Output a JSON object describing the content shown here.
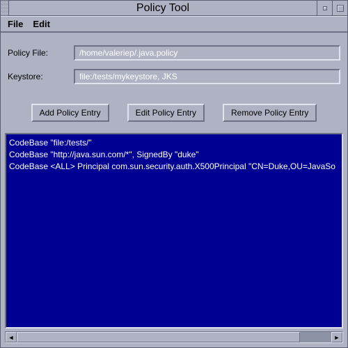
{
  "window": {
    "title": "Policy Tool"
  },
  "menu": {
    "file": "File",
    "edit": "Edit"
  },
  "form": {
    "policy_file_label": "Policy File:",
    "policy_file_value": "/home/valeriep/.java.policy",
    "keystore_label": "Keystore:",
    "keystore_value": "file:/tests/mykeystore, JKS"
  },
  "buttons": {
    "add": "Add Policy Entry",
    "edit": "Edit Policy Entry",
    "remove": "Remove Policy Entry"
  },
  "entries": [
    "CodeBase \"file:/tests/\"",
    "CodeBase \"http://java.sun.com/*\", SignedBy \"duke\"",
    "CodeBase <ALL>  Principal com.sun.security.auth.X500Principal \"CN=Duke,OU=JavaSo"
  ]
}
